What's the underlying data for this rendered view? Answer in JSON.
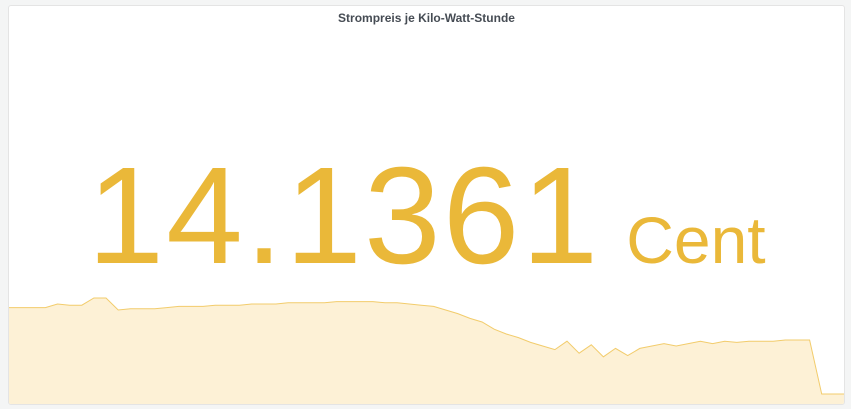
{
  "panel": {
    "title": "Strompreis je Kilo-Watt-Stunde",
    "value": "14.1361",
    "unit": "Cent"
  },
  "colors": {
    "value": "#EAB839",
    "spark_line": "#F2CC6C",
    "spark_fill": "#FDF1D6"
  },
  "chart_data": {
    "type": "area",
    "ylim": [
      0,
      100
    ],
    "values": [
      82,
      82,
      82,
      82,
      85,
      84,
      84,
      90,
      90,
      80,
      81,
      81,
      81,
      82,
      83,
      83,
      83,
      84,
      84,
      84,
      85,
      85,
      85,
      86,
      86,
      86,
      86,
      87,
      87,
      87,
      87,
      86,
      86,
      85,
      84,
      83,
      80,
      77,
      73,
      70,
      64,
      60,
      57,
      53,
      50,
      47,
      54,
      44,
      51,
      41,
      48,
      42,
      48,
      50,
      52,
      50,
      52,
      54,
      52,
      54,
      53,
      54,
      54,
      54,
      55,
      55,
      55,
      10,
      10,
      10
    ]
  }
}
